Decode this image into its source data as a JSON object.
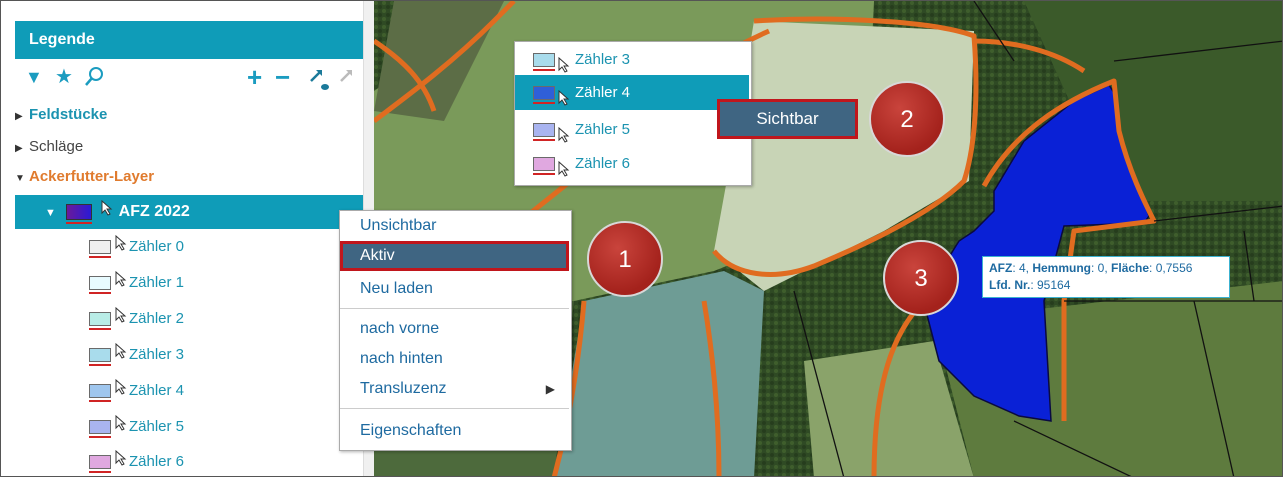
{
  "legend": {
    "title": "Legende",
    "categories": [
      {
        "label": "Feldstücke"
      },
      {
        "label": "Schläge"
      },
      {
        "label": "Ackerfutter-Layer"
      }
    ],
    "layer": {
      "label": "AFZ 2022"
    },
    "counters": [
      {
        "label": "Zähler 0",
        "color": "#f0f0f0"
      },
      {
        "label": "Zähler 1",
        "color": "#e8fbff"
      },
      {
        "label": "Zähler 2",
        "color": "#b8ece6"
      },
      {
        "label": "Zähler 3",
        "color": "#a9dcec"
      },
      {
        "label": "Zähler 4",
        "color": "#9fc6ee"
      },
      {
        "label": "Zähler 5",
        "color": "#a9b4f0"
      },
      {
        "label": "Zähler 6",
        "color": "#e0a8e0"
      }
    ]
  },
  "context_menu": {
    "items": [
      "Unsichtbar",
      "Aktiv",
      "Neu laden",
      "nach vorne",
      "nach hinten",
      "Transluzenz",
      "Eigenschaften"
    ],
    "selected": "Aktiv"
  },
  "submenu": {
    "items": [
      {
        "label": "Zähler 3",
        "color": "#a9dcec"
      },
      {
        "label": "Zähler 4",
        "color": "#2f5fd8"
      },
      {
        "label": "Zähler 5",
        "color": "#a9b4f0"
      },
      {
        "label": "Zähler 6",
        "color": "#e0a8e0"
      }
    ],
    "selected": "Zähler 4"
  },
  "sichtbar_label": "Sichtbar",
  "badges": [
    "1",
    "2",
    "3"
  ],
  "tooltip": {
    "afz_label": "AFZ",
    "afz_value": ": 4, ",
    "hemmung_label": "Hemmung",
    "hemmung_value": ": 0, ",
    "flaeche_label": "Fläche",
    "flaeche_value": ": 0,7556",
    "lfd_label": "Lfd. Nr.",
    "lfd_value": ": 95164"
  },
  "colors": {
    "accent": "#0f9cb8",
    "highlight_border": "#c0161c",
    "selected_field": "#0a21d6"
  }
}
